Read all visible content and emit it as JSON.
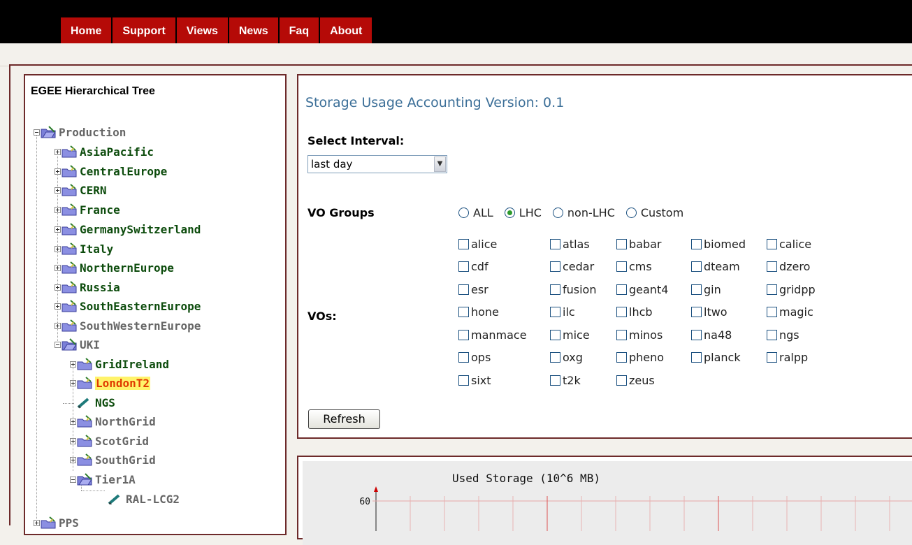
{
  "nav": {
    "tabs": [
      "Home",
      "Support",
      "Views",
      "News",
      "Faq",
      "About"
    ]
  },
  "tree": {
    "title": "EGEE Hierarchical Tree",
    "nodes": [
      {
        "label": "Production"
      },
      {
        "label": "AsiaPacific"
      },
      {
        "label": "CentralEurope"
      },
      {
        "label": "CERN"
      },
      {
        "label": "France"
      },
      {
        "label": "GermanySwitzerland"
      },
      {
        "label": "Italy"
      },
      {
        "label": "NorthernEurope"
      },
      {
        "label": "Russia"
      },
      {
        "label": "SouthEasternEurope"
      },
      {
        "label": "SouthWesternEurope"
      },
      {
        "label": "UKI"
      },
      {
        "label": "GridIreland"
      },
      {
        "label": "LondonT2"
      },
      {
        "label": "NGS"
      },
      {
        "label": "NorthGrid"
      },
      {
        "label": "ScotGrid"
      },
      {
        "label": "SouthGrid"
      },
      {
        "label": "Tier1A"
      },
      {
        "label": "RAL-LCG2"
      },
      {
        "label": "PPS"
      }
    ]
  },
  "form": {
    "title": "Storage Usage Accounting Version: 0.1",
    "interval_label": "Select Interval:",
    "interval_value": "last day",
    "vo_groups_label": "VO Groups",
    "vo_groups": [
      "ALL",
      "LHC",
      "non-LHC",
      "Custom"
    ],
    "vo_group_selected": "LHC",
    "vos_label": "VOs:",
    "vos": [
      "alice",
      "atlas",
      "babar",
      "biomed",
      "calice",
      "cdf",
      "cedar",
      "cms",
      "dteam",
      "dzero",
      "esr",
      "fusion",
      "geant4",
      "gin",
      "gridpp",
      "hone",
      "ilc",
      "lhcb",
      "ltwo",
      "magic",
      "manmace",
      "mice",
      "minos",
      "na48",
      "ngs",
      "ops",
      "oxg",
      "pheno",
      "planck",
      "ralpp",
      "sixt",
      "t2k",
      "zeus"
    ],
    "refresh_label": "Refresh"
  },
  "chart_data": {
    "type": "line",
    "title": "Used Storage (10^6 MB)",
    "y_ticks": [
      "60"
    ],
    "grid": true,
    "series": []
  }
}
